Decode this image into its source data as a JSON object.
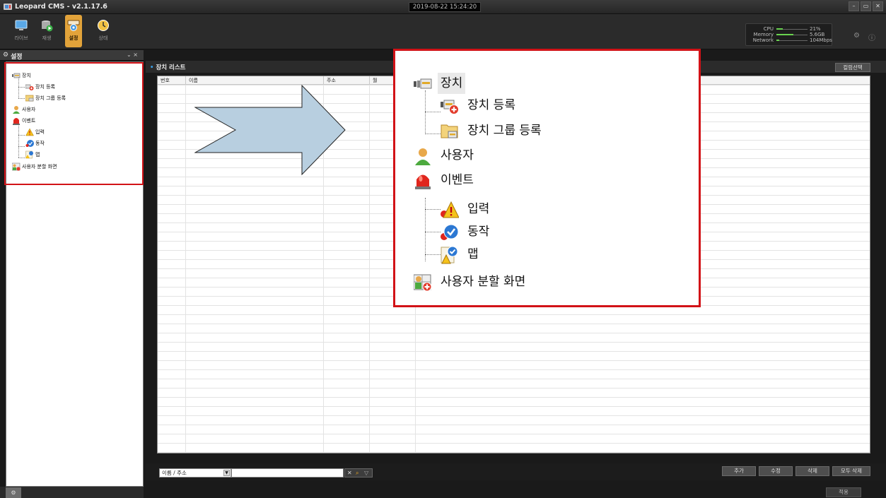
{
  "app": {
    "title": "Leopard CMS - v2.1.17.6",
    "datetime": "2019-08-22 15:24:20",
    "window_controls": [
      "–",
      "▭",
      "✕"
    ]
  },
  "toolbar": {
    "tools": [
      {
        "label": "라이브",
        "icon": "monitor-icon",
        "active": false
      },
      {
        "label": "재생",
        "icon": "playback-icon",
        "active": false
      },
      {
        "label": "설정",
        "icon": "settings-icon",
        "active": true
      },
      {
        "label": "상태",
        "icon": "status-icon",
        "active": false
      }
    ],
    "stats": [
      {
        "name": "CPU",
        "value": "21%",
        "fill": 0.21
      },
      {
        "name": "Memory",
        "value": "5.6GB",
        "fill": 0.55
      },
      {
        "name": "Network",
        "value": "104Mbps",
        "fill": 0.1
      }
    ]
  },
  "left_panel": {
    "title": "설정",
    "controls": "⌄ ×",
    "tree": [
      {
        "label": "장치",
        "icon": "device-icon"
      },
      {
        "label": "장치 등록",
        "icon": "device-add-icon"
      },
      {
        "label": "장치 그룹 등록",
        "icon": "device-group-icon"
      },
      {
        "label": "사용자",
        "icon": "user-icon"
      },
      {
        "label": "이벤트",
        "icon": "event-siren-icon"
      },
      {
        "label": "입력",
        "icon": "input-warning-icon"
      },
      {
        "label": "동작",
        "icon": "action-check-icon"
      },
      {
        "label": "맵",
        "icon": "map-icon"
      },
      {
        "label": "사용자 분할 화면",
        "icon": "user-layout-icon"
      }
    ]
  },
  "main": {
    "title": "장치 리스트",
    "select_button": "컬럼선택",
    "columns": [
      "번호",
      "이름",
      "주소",
      "월"
    ],
    "search": {
      "field_value": "이름 / 주소",
      "query": ""
    },
    "buttons": {
      "add": "추가",
      "edit": "수정",
      "delete": "삭제",
      "delete_all": "모두 삭제"
    },
    "apply": "적용"
  },
  "colors": {
    "highlight": "#d21217",
    "active_tool": "#e2a33a",
    "arrow_fill": "#b8cfe0"
  }
}
